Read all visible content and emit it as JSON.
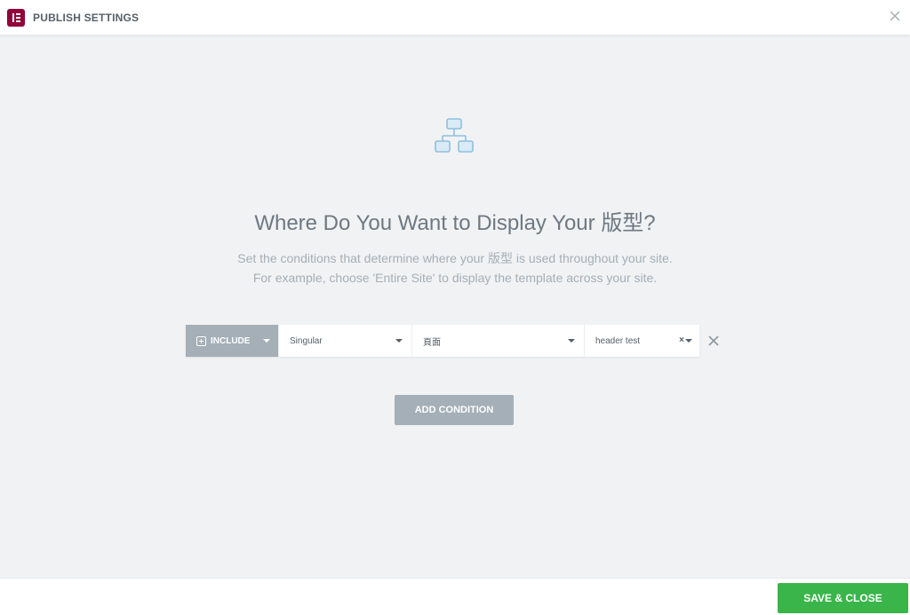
{
  "header": {
    "title": "PUBLISH SETTINGS",
    "logo_icon": "elementor-logo-icon",
    "close_icon": "close-icon"
  },
  "main": {
    "hero_icon": "sitemap-icon",
    "headline": "Where Do You Want to Display Your 版型?",
    "description_line1": "Set the conditions that determine where your 版型 is used throughout your site.",
    "description_line2": "For example, choose 'Entire Site' to display the template across your site."
  },
  "condition": {
    "type_label": "INCLUDE",
    "type_icon": "plus-square-icon",
    "scope_value": "Singular",
    "subtype_value": "頁面",
    "target_value": "header test",
    "clear_symbol": "×",
    "remove_icon": "remove-icon"
  },
  "actions": {
    "add_condition": "ADD CONDITION",
    "save_close": "SAVE & CLOSE"
  },
  "colors": {
    "brand": "#92003b",
    "accent_gray": "#a4afb7",
    "success": "#39b54a",
    "background": "#f1f2f4"
  }
}
